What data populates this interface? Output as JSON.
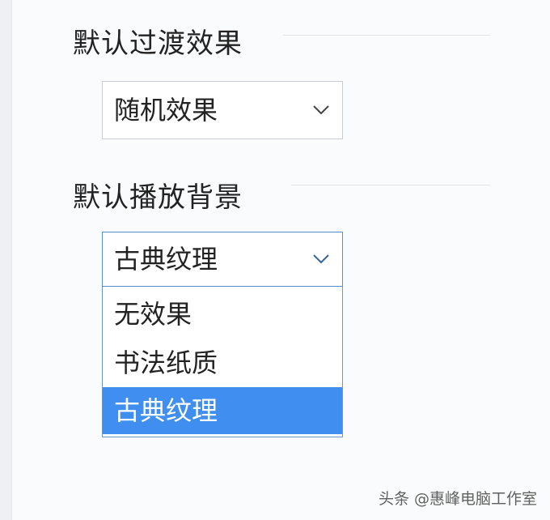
{
  "settings": {
    "transition": {
      "label": "默认过渡效果",
      "selected": "随机效果"
    },
    "background": {
      "label": "默认播放背景",
      "selected": "古典纹理",
      "options": [
        {
          "label": "无效果"
        },
        {
          "label": "书法纸质"
        },
        {
          "label": "古典纹理"
        }
      ],
      "highlighted_option": "古典纹理"
    }
  },
  "watermark": "头条 @惠峰电脑工作室",
  "icons": {
    "select_arrow": "chevron-down-icon"
  },
  "colors": {
    "text": "#222222",
    "border": "#c8cdd3",
    "focus_border": "#5b8fc8",
    "selected_option_bg": "#3f8ef0",
    "selected_option_text": "#ffffff"
  }
}
